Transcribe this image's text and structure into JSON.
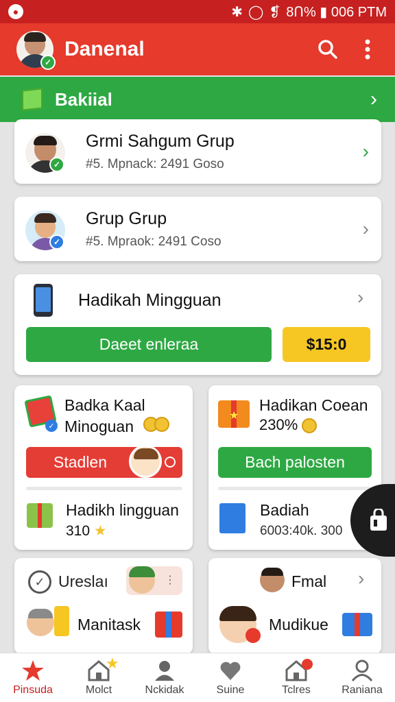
{
  "status_bar": {
    "left_icon": "circle-icon",
    "right_text": "8Ո% ▮ 006 PTM",
    "signal": "❡"
  },
  "app_bar": {
    "title": "Danenal",
    "icons": [
      "search-icon",
      "more-vert-icon"
    ]
  },
  "section": {
    "title": "Bakiial"
  },
  "groups": [
    {
      "title": "Grmi Sahgum Grup",
      "subtitle": "#5. Mpnack: 2491 Goso"
    },
    {
      "title": "Grup Grup",
      "subtitle": "#5. Mpraok: 2491 Coso"
    }
  ],
  "weekly": {
    "title": "Hadikah Mingguan",
    "button_label": "Daeet enleraa",
    "amount": "$15:0"
  },
  "tile1": {
    "title": "Badka Kaal",
    "subtitle": "Minoguan",
    "button_label": "Stadlen",
    "item_title": "Hadikh lingguan",
    "item_value": "310"
  },
  "tile2": {
    "title": "Hadikan Coean",
    "subtitle": "230%",
    "button_label": "Bach palosten",
    "item_title": "Badiah",
    "item_value": "6003:40k. 300"
  },
  "tile3": {
    "title": "Ureslaı",
    "item_title": "Manitask"
  },
  "tile4": {
    "title": "Fmal",
    "item_title": "Mudikue"
  },
  "nav": [
    {
      "label": "Pinsuda",
      "icon": "star-icon"
    },
    {
      "label": "Molct",
      "icon": "home-icon"
    },
    {
      "label": "Nckidak",
      "icon": "person-icon"
    },
    {
      "label": "Suine",
      "icon": "heart-icon"
    },
    {
      "label": "Tclres",
      "icon": "home-icon"
    },
    {
      "label": "Raniana",
      "icon": "person-icon"
    }
  ],
  "colors": {
    "red": "#e53a2c",
    "green": "#2ea843",
    "yellow": "#f6c623"
  }
}
